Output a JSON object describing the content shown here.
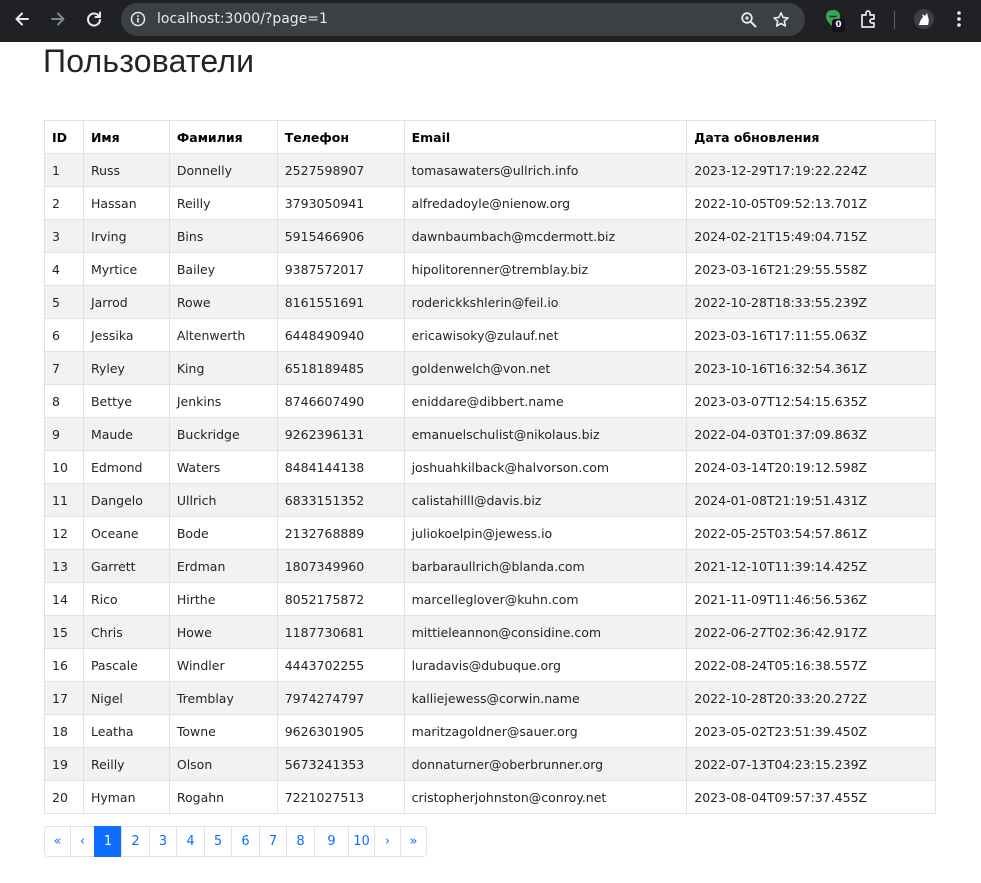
{
  "browser": {
    "url": "localhost:3000/?page=1",
    "extension_badge": "0"
  },
  "page": {
    "title": "Пользователи"
  },
  "table": {
    "headers": [
      "ID",
      "Имя",
      "Фамилия",
      "Телефон",
      "Email",
      "Дата обновления"
    ],
    "rows": [
      [
        "1",
        "Russ",
        "Donnelly",
        "2527598907",
        "tomasawaters@ullrich.info",
        "2023-12-29T17:19:22.224Z"
      ],
      [
        "2",
        "Hassan",
        "Reilly",
        "3793050941",
        "alfredadoyle@nienow.org",
        "2022-10-05T09:52:13.701Z"
      ],
      [
        "3",
        "Irving",
        "Bins",
        "5915466906",
        "dawnbaumbach@mcdermott.biz",
        "2024-02-21T15:49:04.715Z"
      ],
      [
        "4",
        "Myrtice",
        "Bailey",
        "9387572017",
        "hipolitorenner@tremblay.biz",
        "2023-03-16T21:29:55.558Z"
      ],
      [
        "5",
        "Jarrod",
        "Rowe",
        "8161551691",
        "roderickkshlerin@feil.io",
        "2022-10-28T18:33:55.239Z"
      ],
      [
        "6",
        "Jessika",
        "Altenwerth",
        "6448490940",
        "ericawisoky@zulauf.net",
        "2023-03-16T17:11:55.063Z"
      ],
      [
        "7",
        "Ryley",
        "King",
        "6518189485",
        "goldenwelch@von.net",
        "2023-10-16T16:32:54.361Z"
      ],
      [
        "8",
        "Bettye",
        "Jenkins",
        "8746607490",
        "eniddare@dibbert.name",
        "2023-03-07T12:54:15.635Z"
      ],
      [
        "9",
        "Maude",
        "Buckridge",
        "9262396131",
        "emanuelschulist@nikolaus.biz",
        "2022-04-03T01:37:09.863Z"
      ],
      [
        "10",
        "Edmond",
        "Waters",
        "8484144138",
        "joshuahkilback@halvorson.com",
        "2024-03-14T20:19:12.598Z"
      ],
      [
        "11",
        "Dangelo",
        "Ullrich",
        "6833151352",
        "calistahilll@davis.biz",
        "2024-01-08T21:19:51.431Z"
      ],
      [
        "12",
        "Oceane",
        "Bode",
        "2132768889",
        "juliokoelpin@jewess.io",
        "2022-05-25T03:54:57.861Z"
      ],
      [
        "13",
        "Garrett",
        "Erdman",
        "1807349960",
        "barbaraullrich@blanda.com",
        "2021-12-10T11:39:14.425Z"
      ],
      [
        "14",
        "Rico",
        "Hirthe",
        "8052175872",
        "marcelleglover@kuhn.com",
        "2021-11-09T11:46:56.536Z"
      ],
      [
        "15",
        "Chris",
        "Howe",
        "1187730681",
        "mittieleannon@considine.com",
        "2022-06-27T02:36:42.917Z"
      ],
      [
        "16",
        "Pascale",
        "Windler",
        "4443702255",
        "luradavis@dubuque.org",
        "2022-08-24T05:16:38.557Z"
      ],
      [
        "17",
        "Nigel",
        "Tremblay",
        "7974274797",
        "kalliejewess@corwin.name",
        "2022-10-28T20:33:20.272Z"
      ],
      [
        "18",
        "Leatha",
        "Towne",
        "9626301905",
        "maritzagoldner@sauer.org",
        "2023-05-02T23:51:39.450Z"
      ],
      [
        "19",
        "Reilly",
        "Olson",
        "5673241353",
        "donnaturner@oberbrunner.org",
        "2022-07-13T04:23:15.239Z"
      ],
      [
        "20",
        "Hyman",
        "Rogahn",
        "7221027513",
        "cristopherjohnston@conroy.net",
        "2023-08-04T09:57:37.455Z"
      ]
    ]
  },
  "pagination": {
    "items": [
      {
        "label": "«",
        "active": false
      },
      {
        "label": "‹",
        "active": false
      },
      {
        "label": "1",
        "active": true
      },
      {
        "label": "2",
        "active": false
      },
      {
        "label": "3",
        "active": false
      },
      {
        "label": "4",
        "active": false
      },
      {
        "label": "5",
        "active": false
      },
      {
        "label": "6",
        "active": false
      },
      {
        "label": "7",
        "active": false
      },
      {
        "label": "8",
        "active": false
      },
      {
        "label": "9",
        "active": false
      },
      {
        "label": "10",
        "active": false
      },
      {
        "label": "›",
        "active": false
      },
      {
        "label": "»",
        "active": false
      }
    ]
  },
  "colors": {
    "chrome_bg": "#202124",
    "omnibox_bg": "#3c4043",
    "accent": "#0d6efd",
    "row_stripe": "#f2f2f2",
    "border": "#dee2e6"
  },
  "icons": {
    "back": "arrow-left-icon",
    "forward": "arrow-right-icon",
    "reload": "reload-icon",
    "site_info": "site-info-icon",
    "zoom": "zoom-icon",
    "bookmark": "star-icon",
    "extension": "extension-icon",
    "puzzle": "puzzle-icon",
    "profile": "profile-icon",
    "menu": "kebab-menu-icon"
  }
}
